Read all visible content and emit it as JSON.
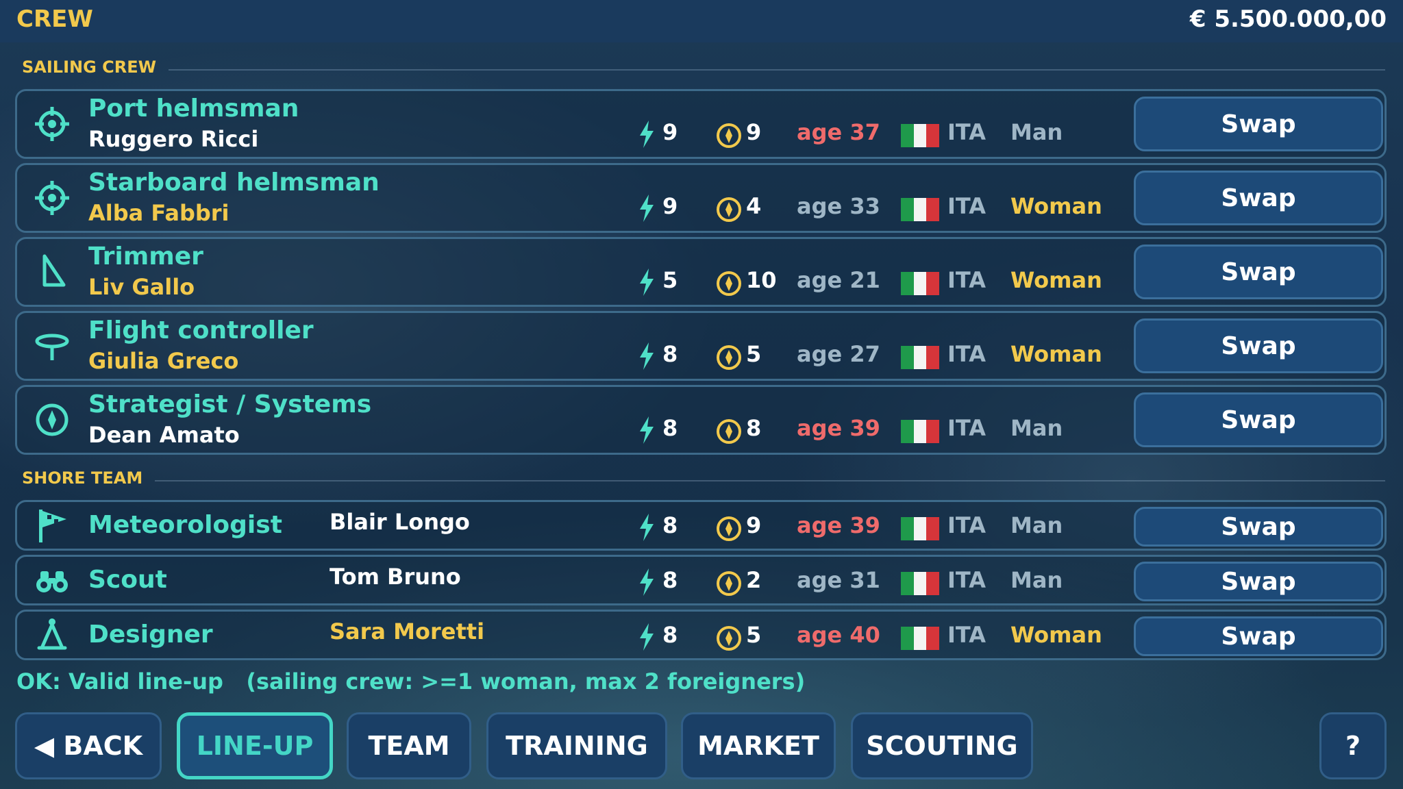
{
  "header": {
    "title": "CREW",
    "budget": "€ 5.500.000,00"
  },
  "sections": {
    "sailing": "SAILING CREW",
    "shore": "SHORE TEAM"
  },
  "sailing_crew": [
    {
      "role": "Port helmsman",
      "name": "Ruggero Ricci",
      "name_color": "#ffffff",
      "speed": "9",
      "skill": "9",
      "age": "age 37",
      "age_color": "#ef6b6b",
      "country": "ITA",
      "gender": "Man",
      "gender_color": "#9fb6c6",
      "icon": "crosshair-icon",
      "swap": "Swap"
    },
    {
      "role": "Starboard helmsman",
      "name": "Alba Fabbri",
      "name_color": "#f2c94c",
      "speed": "9",
      "skill": "4",
      "age": "age 33",
      "age_color": "#9fb6c6",
      "country": "ITA",
      "gender": "Woman",
      "gender_color": "#f2c94c",
      "icon": "crosshair-icon",
      "swap": "Swap"
    },
    {
      "role": "Trimmer",
      "name": "Liv Gallo",
      "name_color": "#f2c94c",
      "speed": "5",
      "skill": "10",
      "age": "age 21",
      "age_color": "#9fb6c6",
      "country": "ITA",
      "gender": "Woman",
      "gender_color": "#f2c94c",
      "icon": "sail-icon",
      "swap": "Swap"
    },
    {
      "role": "Flight controller",
      "name": "Giulia Greco",
      "name_color": "#f2c94c",
      "speed": "8",
      "skill": "5",
      "age": "age 27",
      "age_color": "#9fb6c6",
      "country": "ITA",
      "gender": "Woman",
      "gender_color": "#f2c94c",
      "icon": "foil-icon",
      "swap": "Swap"
    },
    {
      "role": "Strategist / Systems",
      "name": "Dean Amato",
      "name_color": "#ffffff",
      "speed": "8",
      "skill": "8",
      "age": "age 39",
      "age_color": "#ef6b6b",
      "country": "ITA",
      "gender": "Man",
      "gender_color": "#9fb6c6",
      "icon": "compass-icon",
      "swap": "Swap"
    }
  ],
  "shore_team": [
    {
      "role": "Meteorologist",
      "name": "Blair Longo",
      "name_color": "#ffffff",
      "speed": "8",
      "skill": "9",
      "age": "age 39",
      "age_color": "#ef6b6b",
      "country": "ITA",
      "gender": "Man",
      "gender_color": "#9fb6c6",
      "icon": "flag-icon",
      "swap": "Swap"
    },
    {
      "role": "Scout",
      "name": "Tom Bruno",
      "name_color": "#ffffff",
      "speed": "8",
      "skill": "2",
      "age": "age 31",
      "age_color": "#9fb6c6",
      "country": "ITA",
      "gender": "Man",
      "gender_color": "#9fb6c6",
      "icon": "binoculars-icon",
      "swap": "Swap"
    },
    {
      "role": "Designer",
      "name": "Sara Moretti",
      "name_color": "#f2c94c",
      "speed": "8",
      "skill": "5",
      "age": "age 40",
      "age_color": "#ef6b6b",
      "country": "ITA",
      "gender": "Woman",
      "gender_color": "#f2c94c",
      "icon": "drafting-compass-icon",
      "swap": "Swap"
    }
  ],
  "status": "OK: Valid line-up   (sailing crew: >=1 woman, max 2 foreigners)",
  "nav": {
    "back": "◀ BACK",
    "lineup": "LINE-UP",
    "team": "TEAM",
    "training": "TRAINING",
    "market": "MARKET",
    "scouting": "SCOUTING",
    "help": "?"
  },
  "colors": {
    "accent_teal": "#4fe0c8",
    "gold": "#f2c94c",
    "red_age": "#ef6b6b",
    "muted": "#9fb6c6"
  }
}
